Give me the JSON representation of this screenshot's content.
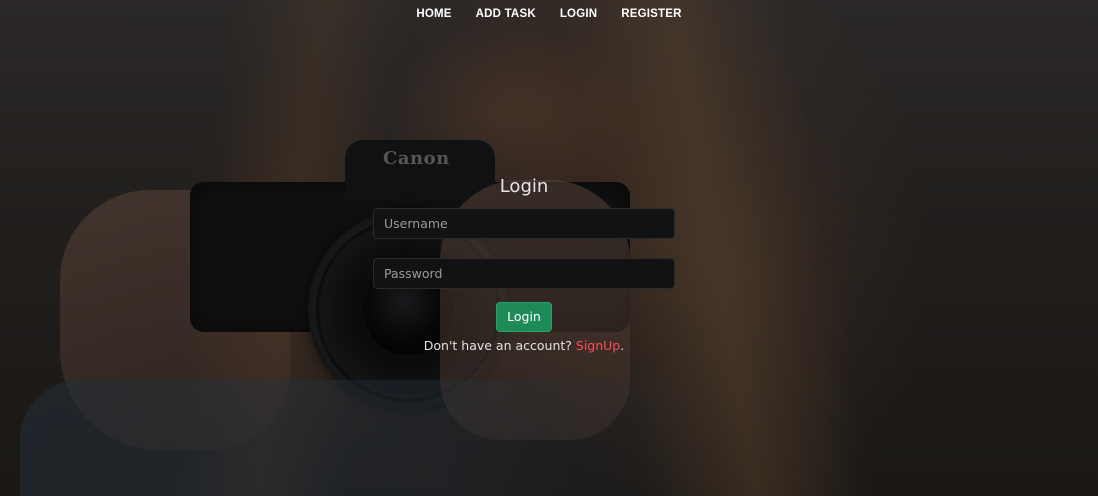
{
  "nav": {
    "items": [
      "HOME",
      "ADD TASK",
      "LOGIN",
      "REGISTER"
    ]
  },
  "background": {
    "brand_text": "Canon"
  },
  "login": {
    "title": "Login",
    "username_placeholder": "Username",
    "password_placeholder": "Password",
    "button_label": "Login",
    "prompt_text": "Don't have an account? ",
    "signup_label": "SignUp",
    "prompt_suffix": "."
  },
  "colors": {
    "button_green": "#1e8a57",
    "link_red": "#ff4a5a",
    "field_bg": "#121212"
  }
}
